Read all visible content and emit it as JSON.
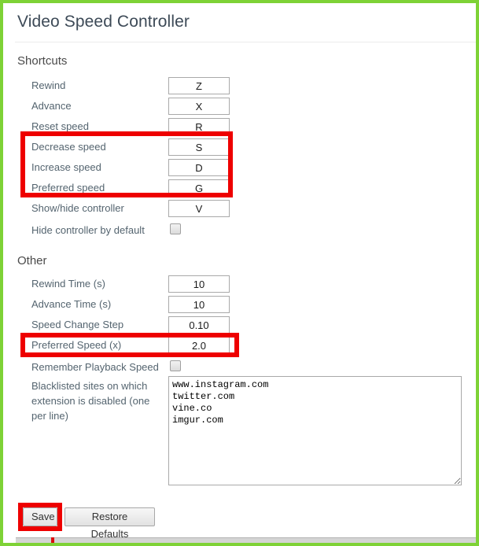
{
  "window": {
    "title": "Video Speed Controller",
    "border_color": "#7ed236",
    "annotation_color": "#ee0000"
  },
  "sections": {
    "shortcuts": {
      "heading": "Shortcuts",
      "rows": [
        {
          "label": "Rewind",
          "value": "Z",
          "type": "text"
        },
        {
          "label": "Advance",
          "value": "X",
          "type": "text"
        },
        {
          "label": "Reset speed",
          "value": "R",
          "type": "text"
        },
        {
          "label": "Decrease speed",
          "value": "S",
          "type": "text"
        },
        {
          "label": "Increase speed",
          "value": "D",
          "type": "text"
        },
        {
          "label": "Preferred speed",
          "value": "G",
          "type": "text"
        },
        {
          "label": "Show/hide controller",
          "value": "V",
          "type": "text"
        },
        {
          "label": "Hide controller by default",
          "value": "",
          "type": "checkbox",
          "checked": false
        }
      ]
    },
    "other": {
      "heading": "Other",
      "rows": [
        {
          "label": "Rewind Time (s)",
          "value": "10",
          "type": "text"
        },
        {
          "label": "Advance Time (s)",
          "value": "10",
          "type": "text"
        },
        {
          "label": "Speed Change Step",
          "value": "0.10",
          "type": "text"
        },
        {
          "label": "Preferred Speed (x)",
          "value": "2.0",
          "type": "text"
        },
        {
          "label": "Remember Playback Speed",
          "value": "",
          "type": "checkbox",
          "checked": false
        }
      ]
    }
  },
  "blacklist": {
    "label": "Blacklisted sites on which extension is disabled (one per line)",
    "value": "www.instagram.com\ntwitter.com\nvine.co\nimgur.com"
  },
  "buttons": {
    "save": "Save",
    "restore": "Restore Defaults"
  }
}
